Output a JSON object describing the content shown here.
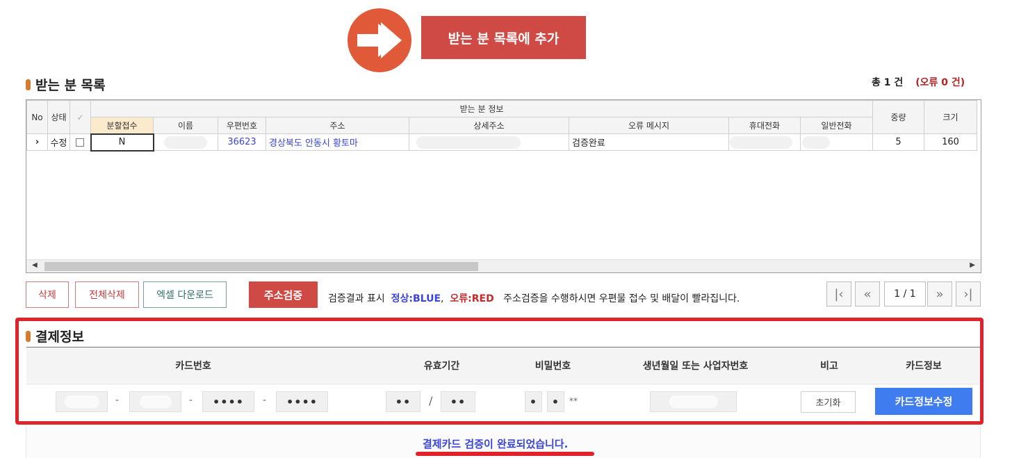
{
  "top": {
    "add_label": "받는 분 목록에 추가",
    "arrow_icon": "arrow-right-icon"
  },
  "recipients": {
    "title": "받는 분 목록",
    "summary_total": "총 1 건",
    "summary_error": "(오류 0 건)",
    "group_header": "받는 분 정보",
    "headers": {
      "no": "No",
      "status": "상태",
      "check": "✓",
      "split": "분할접수",
      "name": "이름",
      "zip": "우편번호",
      "addr": "주소",
      "addr_detail": "상세주소",
      "error_msg": "오류 메시지",
      "mobile": "휴대전화",
      "phone": "일반전화",
      "weight": "중량",
      "size": "크기"
    },
    "rows": [
      {
        "marker": "›",
        "status": "수정",
        "split": "N",
        "zip": "36623",
        "addr": "경상북도 안동시 황토마",
        "error_msg": "검증완료",
        "weight": "5",
        "size": "160"
      }
    ]
  },
  "toolbar": {
    "delete": "삭제",
    "delete_all": "전체삭제",
    "excel": "엑셀 다운로드",
    "verify": "주소검증",
    "legend_prefix": "검증결과 표시",
    "legend_normal": "정상:BLUE",
    "legend_comma": ",",
    "legend_error": "오류:RED",
    "legend_hint": "주소검증을 수행하시면 우편물 접수 및 배달이 빨라집니다.",
    "page_indicator": "1 / 1"
  },
  "payment": {
    "title": "결제정보",
    "headers": {
      "card_no": "카드번호",
      "expiry": "유효기간",
      "password": "비밀번호",
      "birth": "생년월일 또는 사업자번호",
      "note": "비고",
      "card_info": "카드정보"
    },
    "card_part3": "••••",
    "card_part4": "••••",
    "expiry_mm": "••",
    "expiry_yy": "••",
    "expiry_sep": "/",
    "pw_1": "•",
    "pw_2": "•",
    "pw_suffix": "**",
    "dash": "-",
    "reset": "초기화",
    "edit_card": "카드정보수정",
    "done_message": "결제카드 검증이 완료되었습니다."
  },
  "colors": {
    "accent_red": "#cf4a45",
    "highlight_border": "#e0232b",
    "normal_blue": "#3a44d8",
    "primary_button": "#3f7cf0"
  }
}
